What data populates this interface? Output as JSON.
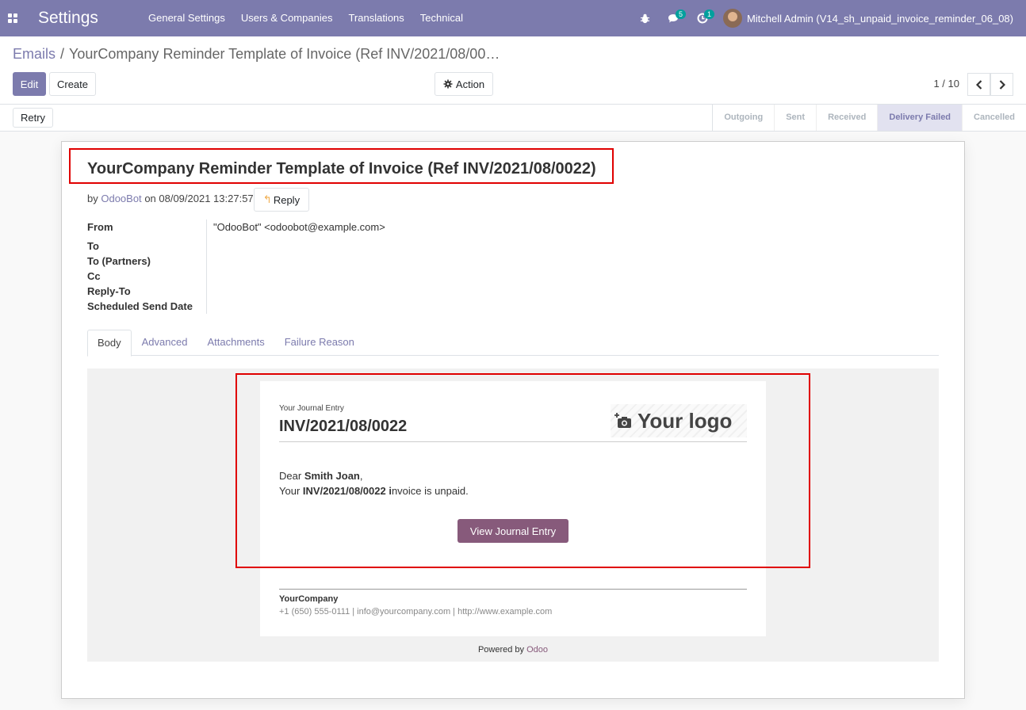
{
  "navbar": {
    "app_title": "Settings",
    "menu": [
      "General Settings",
      "Users & Companies",
      "Translations",
      "Technical"
    ],
    "messages_badge": "5",
    "activities_badge": "1",
    "user_name": "Mitchell Admin (V14_sh_unpaid_invoice_reminder_06_08)"
  },
  "breadcrumb": {
    "parent": "Emails",
    "separator": "/",
    "current": "YourCompany Reminder Template of Invoice (Ref INV/2021/08/00…"
  },
  "toolbar": {
    "edit_label": "Edit",
    "create_label": "Create",
    "action_label": "Action",
    "pager_text": "1 / 10"
  },
  "statusbar": {
    "retry_label": "Retry",
    "steps": [
      "Outgoing",
      "Sent",
      "Received",
      "Delivery Failed",
      "Cancelled"
    ],
    "active_step": "Delivery Failed"
  },
  "message": {
    "subject": "YourCompany Reminder Template of Invoice (Ref INV/2021/08/0022)",
    "by_prefix": "by",
    "author": "OdooBot",
    "on_date": "on 08/09/2021 13:27:57",
    "reply_label": "Reply"
  },
  "fields": {
    "from_label": "From",
    "from_value": "\"OdooBot\" <odoobot@example.com>",
    "to_label": "To",
    "to_partners_label": "To (Partners)",
    "cc_label": "Cc",
    "reply_to_label": "Reply-To",
    "scheduled_label": "Scheduled Send Date"
  },
  "tabs": [
    "Body",
    "Advanced",
    "Attachments",
    "Failure Reason"
  ],
  "email": {
    "doc_label": "Your Journal Entry",
    "doc_name": "INV/2021/08/0022",
    "logo_text": "Your logo",
    "dear": "Dear",
    "customer": "Smith Joan",
    "comma": ",",
    "your": "Your",
    "invoice_ref": "INV/2021/08/0022 i",
    "unpaid_text": "nvoice is unpaid.",
    "button_label": "View Journal Entry",
    "company": "YourCompany",
    "contact": "+1 (650) 555-0111 | info@yourcompany.com | http://www.example.com",
    "powered_by": "Powered by",
    "odoo": "Odoo"
  },
  "colors": {
    "brand": "#7c7bad",
    "highlight_box": "#e00000",
    "email_button": "#875a7b"
  }
}
